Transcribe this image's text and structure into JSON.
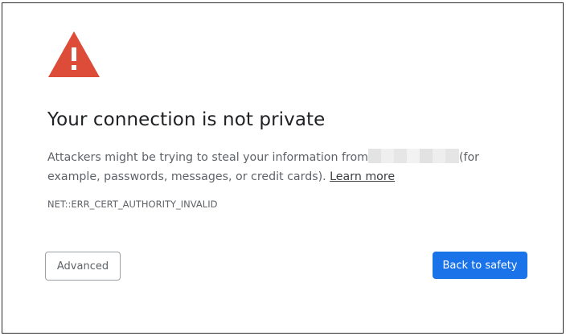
{
  "page": {
    "title": "Your connection is not private",
    "description_before": "Attackers might be trying to steal your information from",
    "description_after": "(for example, passwords, messages, or credit cards).",
    "learn_more_link": "Learn more",
    "error_code": "NET::ERR_CERT_AUTHORITY_INVALID",
    "warning_icon": "warning-triangle-icon",
    "warning_color": "#dd4b39"
  },
  "buttons": {
    "advanced_label": "Advanced",
    "back_label": "Back to safety",
    "back_color": "#1a73e8"
  }
}
